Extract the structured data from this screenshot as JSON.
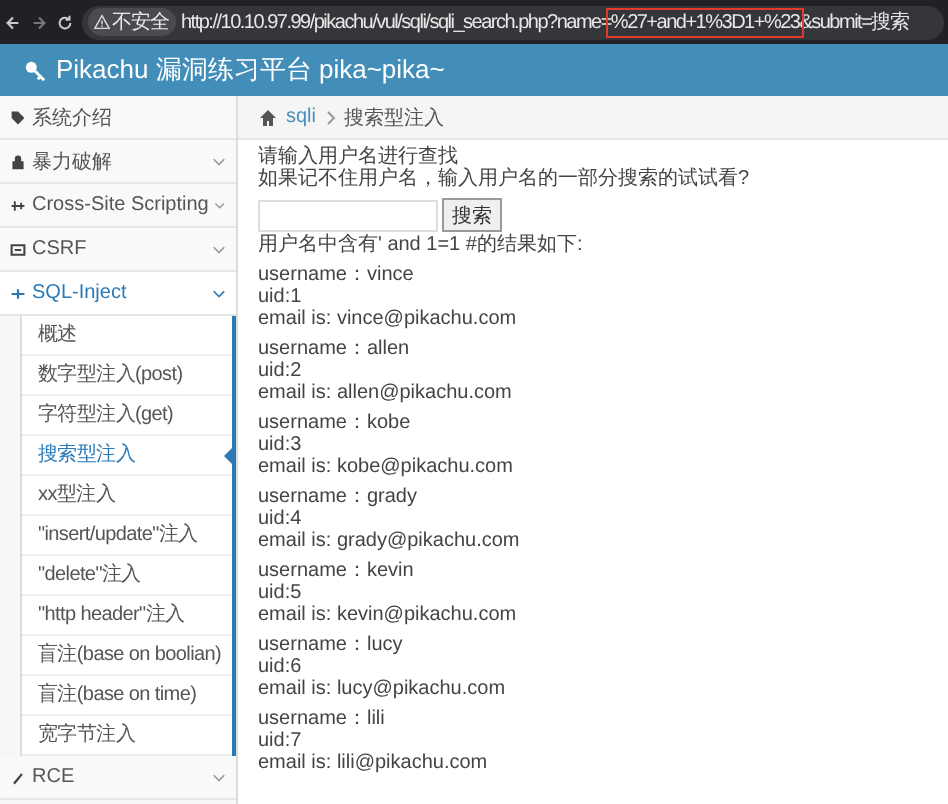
{
  "browser": {
    "security_label": "不安全",
    "url_parts": [
      {
        "text": "http://10.10.97.99/pikachu/vul/sqli/sqli_search.php?name=",
        "highlighted": false
      },
      {
        "text": "%27+and+1%3D1+%23",
        "highlighted": true
      },
      {
        "text": "&submit=搜索",
        "highlighted": false
      }
    ]
  },
  "header": {
    "title": "Pikachu 漏洞练习平台 pika~pika~"
  },
  "sidebar": {
    "items": [
      {
        "kind": "link",
        "label": "系统介绍"
      },
      {
        "kind": "group",
        "label": "暴力破解",
        "expanded": false
      },
      {
        "kind": "group",
        "label": "Cross-Site Scripting",
        "expanded": false
      },
      {
        "kind": "group",
        "label": "CSRF",
        "expanded": false
      },
      {
        "kind": "group",
        "label": "SQL-Inject",
        "expanded": true,
        "children": [
          {
            "label": "概述",
            "selected": false
          },
          {
            "label": "数字型注入(post)",
            "selected": false
          },
          {
            "label": "字符型注入(get)",
            "selected": false
          },
          {
            "label": "搜索型注入",
            "selected": true
          },
          {
            "label": "xx型注入",
            "selected": false
          },
          {
            "label": "\"insert/update\"注入",
            "selected": false
          },
          {
            "label": "\"delete\"注入",
            "selected": false
          },
          {
            "label": "\"http header\"注入",
            "selected": false
          },
          {
            "label": "盲注(base on boolian)",
            "selected": false
          },
          {
            "label": "盲注(base on time)",
            "selected": false
          },
          {
            "label": "宽字节注入",
            "selected": false
          }
        ]
      },
      {
        "kind": "group",
        "label": "RCE",
        "expanded": false
      }
    ]
  },
  "breadcrumb": [
    "sqli",
    "搜索型注入"
  ],
  "prompt": [
    "请输入用户名进行查找",
    "如果记不住用户名，输入用户名的一部分搜索的试试看?"
  ],
  "search_button": "搜索",
  "result_heading": "用户名中含有' and 1=1 #的结果如下:",
  "results": [
    {
      "username": "username：vince",
      "uid": "uid:1",
      "email": "email is: vince@pikachu.com"
    },
    {
      "username": "username：allen",
      "uid": "uid:2",
      "email": "email is: allen@pikachu.com"
    },
    {
      "username": "username：kobe",
      "uid": "uid:3",
      "email": "email is: kobe@pikachu.com"
    },
    {
      "username": "username：grady",
      "uid": "uid:4",
      "email": "email is: grady@pikachu.com"
    },
    {
      "username": "username：kevin",
      "uid": "uid:5",
      "email": "email is: kevin@pikachu.com"
    },
    {
      "username": "username：lucy",
      "uid": "uid:6",
      "email": "email is: lucy@pikachu.com"
    },
    {
      "username": "username：lili",
      "uid": "uid:7",
      "email": "email is: lili@pikachu.com"
    }
  ]
}
